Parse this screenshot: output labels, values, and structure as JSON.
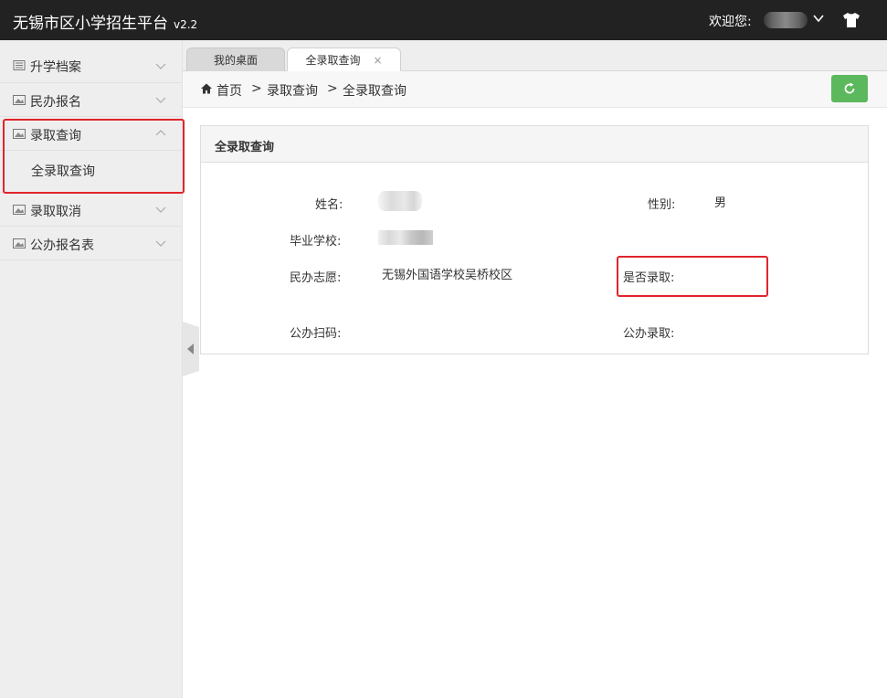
{
  "header": {
    "title": "无锡市区小学招生平台",
    "version": "v2.2",
    "welcome": "欢迎您:"
  },
  "sidebar": {
    "items": [
      {
        "label": "升学档案",
        "icon": "document-icon",
        "expanded": false
      },
      {
        "label": "民办报名",
        "icon": "image-icon",
        "expanded": false
      },
      {
        "label": "录取查询",
        "icon": "image-icon",
        "expanded": true,
        "children": [
          {
            "label": "全录取查询"
          }
        ]
      },
      {
        "label": "录取取消",
        "icon": "image-icon",
        "expanded": false
      },
      {
        "label": "公办报名表",
        "icon": "image-icon",
        "expanded": false
      }
    ]
  },
  "tabs": [
    {
      "label": "我的桌面",
      "active": false
    },
    {
      "label": "全录取查询",
      "active": true,
      "close": "×"
    }
  ],
  "breadcrumb": {
    "home": "首页",
    "sep": ">",
    "level1": "录取查询",
    "level2": "全录取查询"
  },
  "panel": {
    "title": "全录取查询",
    "fields": {
      "name_label": "姓名:",
      "gender_label": "性别:",
      "gender_value": "男",
      "school_label": "毕业学校:",
      "private_choice_label": "民办志愿:",
      "private_choice_value": "无锡外国语学校吴桥校区",
      "admitted_label": "是否录取:",
      "public_scan_label": "公办扫码:",
      "public_admit_label": "公办录取:"
    }
  },
  "colors": {
    "header_bg": "#222222",
    "sidebar_bg": "#eeeeee",
    "refresh_button": "#5cb85c",
    "highlight_border": "#e0252b"
  }
}
